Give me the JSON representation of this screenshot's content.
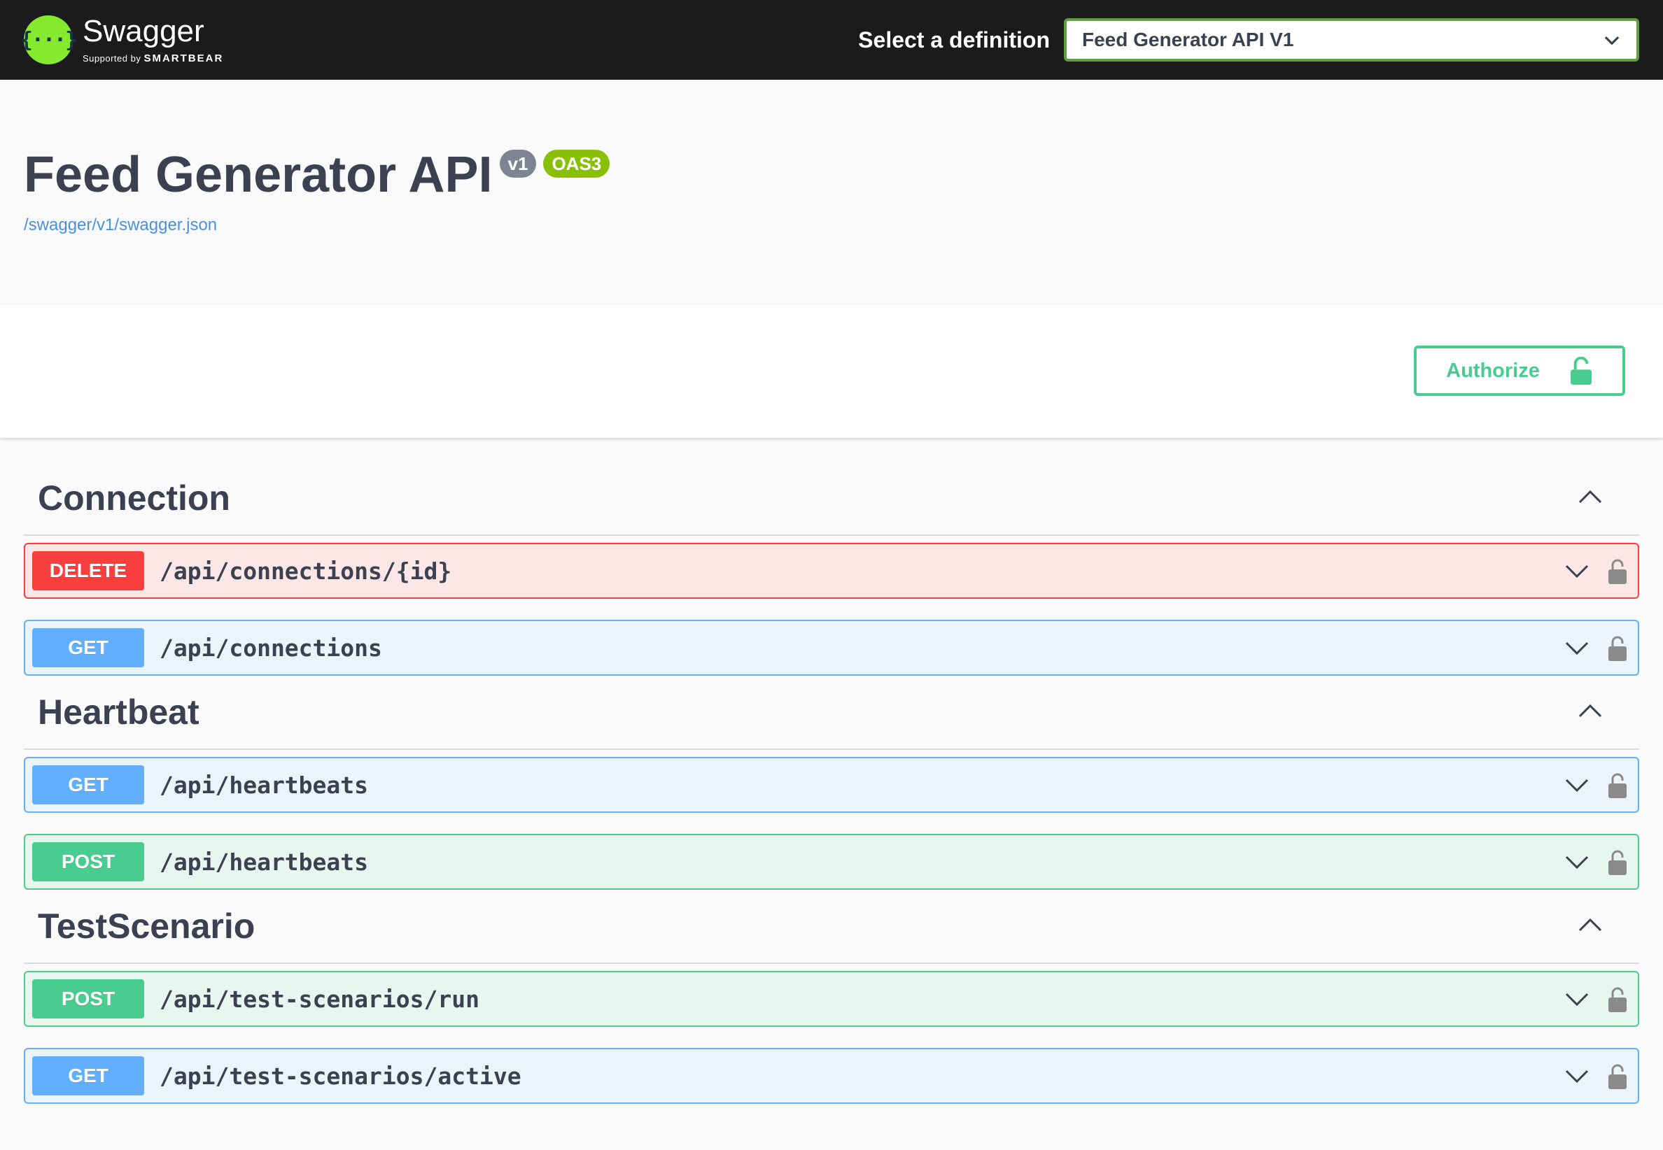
{
  "topbar": {
    "brand_name": "Swagger",
    "brand_sub_prefix": "Supported by",
    "brand_sub_name": "SMARTBEAR",
    "definition_label": "Select a definition",
    "definition_selected": "Feed Generator API V1",
    "logo_glyph": "{···}"
  },
  "info": {
    "title": "Feed Generator API",
    "version_badge": "v1",
    "oas_badge": "OAS3",
    "spec_link": "/swagger/v1/swagger.json"
  },
  "authorize": {
    "label": "Authorize",
    "icon": "unlock-icon"
  },
  "colors": {
    "delete": "#f93e3e",
    "get": "#61affe",
    "post": "#49cc90",
    "authorize": "#49cc90",
    "brand": "#85ea2d"
  },
  "sections": [
    {
      "name": "Connection",
      "operations": [
        {
          "method": "DELETE",
          "path": "/api/connections/{id}"
        },
        {
          "method": "GET",
          "path": "/api/connections"
        }
      ]
    },
    {
      "name": "Heartbeat",
      "operations": [
        {
          "method": "GET",
          "path": "/api/heartbeats"
        },
        {
          "method": "POST",
          "path": "/api/heartbeats"
        }
      ]
    },
    {
      "name": "TestScenario",
      "operations": [
        {
          "method": "POST",
          "path": "/api/test-scenarios/run"
        },
        {
          "method": "GET",
          "path": "/api/test-scenarios/active"
        }
      ]
    }
  ]
}
